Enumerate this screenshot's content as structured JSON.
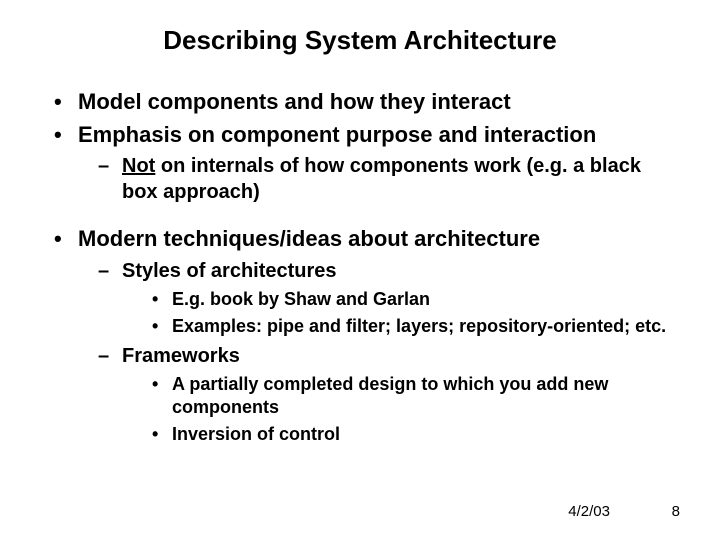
{
  "title": "Describing System Architecture",
  "b1": "Model components and how they interact",
  "b2": "Emphasis on component purpose and interaction",
  "b2_1_not": "Not",
  "b2_1_rest": " on internals of how components work (e.g. a black box approach)",
  "b3": "Modern techniques/ideas about architecture",
  "b3_1": "Styles of architectures",
  "b3_1_1": "E.g. book by Shaw and Garlan",
  "b3_1_2": "Examples:  pipe and filter; layers; repository-oriented; etc.",
  "b3_2": "Frameworks",
  "b3_2_1": "A partially completed design to which you add new components",
  "b3_2_2": "Inversion of control",
  "date": "4/2/03",
  "page": "8"
}
